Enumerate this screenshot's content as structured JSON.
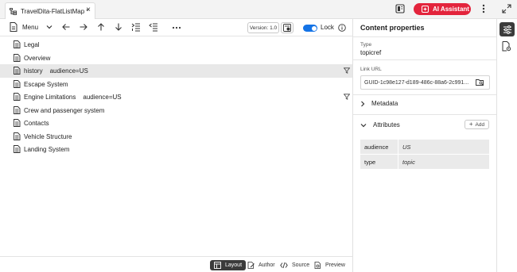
{
  "tab": {
    "title": "TravelDita-FlatListMap *"
  },
  "header": {
    "ai_assistant_label": "AI Assistant"
  },
  "toolbar": {
    "menu_label": "Menu",
    "version_label": "Version: 1.0",
    "lock_label": "Lock",
    "lock_enabled": true
  },
  "topics": [
    {
      "title": "Legal",
      "condition": "",
      "filtered": false,
      "selected": false
    },
    {
      "title": "Overview",
      "condition": "",
      "filtered": false,
      "selected": false
    },
    {
      "title": "history",
      "condition": "audience=US",
      "filtered": true,
      "selected": true
    },
    {
      "title": "Escape System",
      "condition": "",
      "filtered": false,
      "selected": false
    },
    {
      "title": "Engine Limitations",
      "condition": "audience=US",
      "filtered": true,
      "selected": false
    },
    {
      "title": "Crew and passenger system",
      "condition": "",
      "filtered": false,
      "selected": false
    },
    {
      "title": "Contacts",
      "condition": "",
      "filtered": false,
      "selected": false
    },
    {
      "title": "Vehicle Structure",
      "condition": "",
      "filtered": false,
      "selected": false
    },
    {
      "title": "Landing System",
      "condition": "",
      "filtered": false,
      "selected": false
    }
  ],
  "views": {
    "layout": "Layout",
    "author": "Author",
    "source": "Source",
    "preview": "Preview",
    "active": "layout"
  },
  "panel": {
    "title": "Content properties",
    "type_label": "Type",
    "type_value": "topicref",
    "link_label": "Link URL",
    "link_value": "GUID-1c98e127-d189-486c-88a6-2c991...",
    "metadata_label": "Metadata",
    "attributes_label": "Attributes",
    "add_label": "Add",
    "attributes": [
      {
        "key": "audience",
        "value": "US"
      },
      {
        "key": "type",
        "value": "topic"
      }
    ]
  },
  "colors": {
    "accent": "#1473e6",
    "ai_button": "#e3243c",
    "active_dark": "#3b3b3b",
    "selected_row": "#e8e8e8"
  }
}
